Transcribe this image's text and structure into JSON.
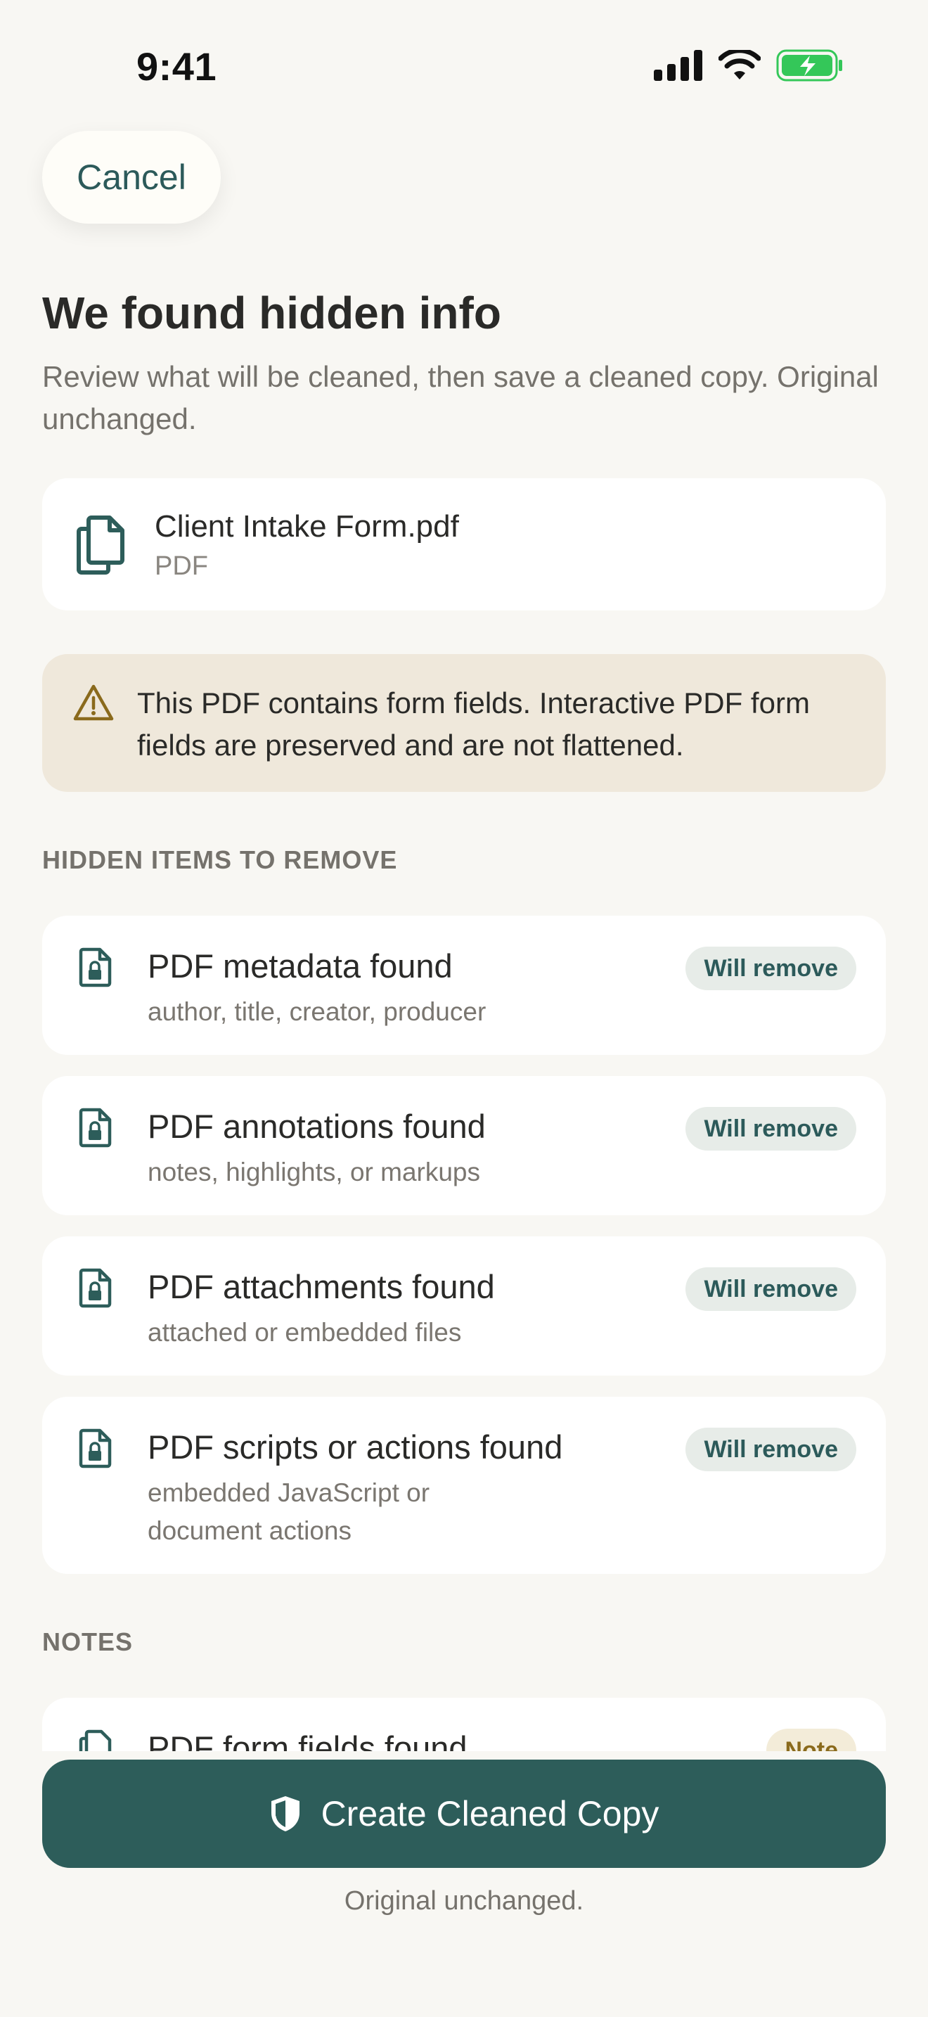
{
  "status_bar": {
    "time": "9:41"
  },
  "nav": {
    "cancel_label": "Cancel"
  },
  "header": {
    "title": "We found hidden info",
    "subtitle": "Review what will be cleaned, then save a cleaned copy. Original unchanged."
  },
  "file": {
    "name": "Client Intake Form.pdf",
    "type": "PDF"
  },
  "warning": {
    "text": "This PDF contains form fields. Interactive PDF form fields are preserved and are not flattened."
  },
  "sections": {
    "remove_label": "HIDDEN ITEMS TO REMOVE",
    "notes_label": "NOTES"
  },
  "items": [
    {
      "title": "PDF metadata found",
      "desc": "author, title, creator, producer",
      "badge": "Will remove"
    },
    {
      "title": "PDF annotations found",
      "desc": "notes, highlights, or markups",
      "badge": "Will remove"
    },
    {
      "title": "PDF attachments found",
      "desc": "attached or embedded files",
      "badge": "Will remove"
    },
    {
      "title": "PDF scripts or actions found",
      "desc": "embedded JavaScript or document actions",
      "badge": "Will remove"
    }
  ],
  "notes": [
    {
      "title": "PDF form fields found",
      "badge": "Note"
    }
  ],
  "footer": {
    "cta_label": "Create Cleaned Copy",
    "footnote": "Original unchanged."
  },
  "colors": {
    "background": "#F8F7F3",
    "accent": "#2D5D5A",
    "warning_bg": "#EFE8DB",
    "warning_icon": "#8A6A1C",
    "battery": "#34C759"
  },
  "icons": [
    "signal-icon",
    "wifi-icon",
    "battery-icon",
    "document-stack-icon",
    "warning-triangle-icon",
    "locked-document-icon",
    "shield-icon"
  ]
}
